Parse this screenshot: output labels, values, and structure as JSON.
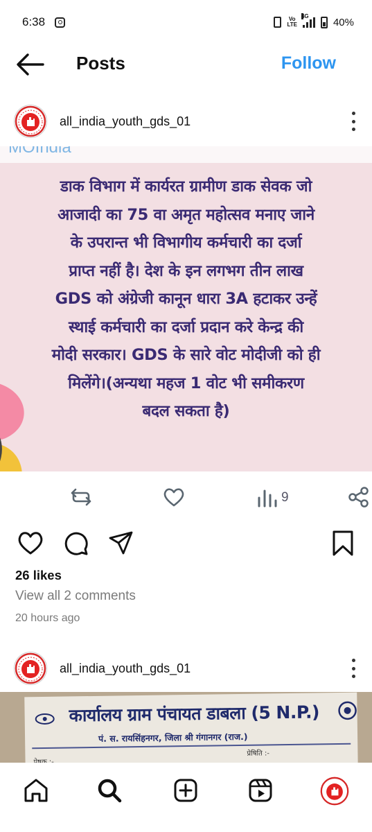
{
  "status_bar": {
    "time": "6:38",
    "volte_label_top": "Vo",
    "volte_label_bottom": "LTE",
    "network": "4G",
    "battery": "40%"
  },
  "header": {
    "title": "Posts",
    "follow_label": "Follow"
  },
  "posts": [
    {
      "username": "all_india_youth_gds_01",
      "image_strip_text": "MOIndia",
      "image_text_lines": [
        "डाक विभाग में कार्यरत ग्रामीण डाक सेवक जो",
        "आजादी का 75 वा अमृत महोत्सव मनाए जाने",
        "के उपरान्त भी विभागीय कर्मचारी का दर्जा",
        "प्राप्त नहीं है। देश के इन लगभग तीन लाख",
        "GDS को अंग्रेजी कानून धारा 3A हटाकर उन्हें",
        "स्थाई कर्मचारी का दर्जा प्रदान करे केन्द्र की",
        "मोदी सरकार। GDS के सारे वोट मोदीजी को ही",
        "मिलेंगे।(अन्यथा महज 1 वोट भी समीकरण",
        "बदल सकता है)"
      ],
      "views": "9",
      "likes": "26 likes",
      "comments_link": "View all 2 comments",
      "timestamp": "20 hours ago"
    },
    {
      "username": "all_india_youth_gds_01",
      "image_title": "कार्यालय ग्राम पंचायत डाबला (5 N.P.)",
      "image_subtitle": "पं. स. रायसिंहनगर, जिला श्री गंगानगर (राज.)",
      "image_small_left": "प्रेषक :-",
      "image_small_right": "प्रेषिति :-"
    }
  ],
  "icons": {
    "back": "arrow-left-icon",
    "more": "three-dots-vertical-icon",
    "retweet": "repost-icon",
    "heart": "heart-icon",
    "views": "bar-chart-icon",
    "share": "share-nodes-icon",
    "comment": "comment-bubble-icon",
    "send": "paper-plane-icon",
    "save": "bookmark-icon",
    "nav_home": "home-icon",
    "nav_search": "search-icon",
    "nav_create": "plus-square-icon",
    "nav_reels": "reels-icon",
    "nav_profile": "profile-avatar-icon"
  },
  "colors": {
    "follow_blue": "#2d95f0",
    "image_bg": "#f3dfe3",
    "image_text": "#3a2a73",
    "secondary_text": "#7a7a7a"
  }
}
